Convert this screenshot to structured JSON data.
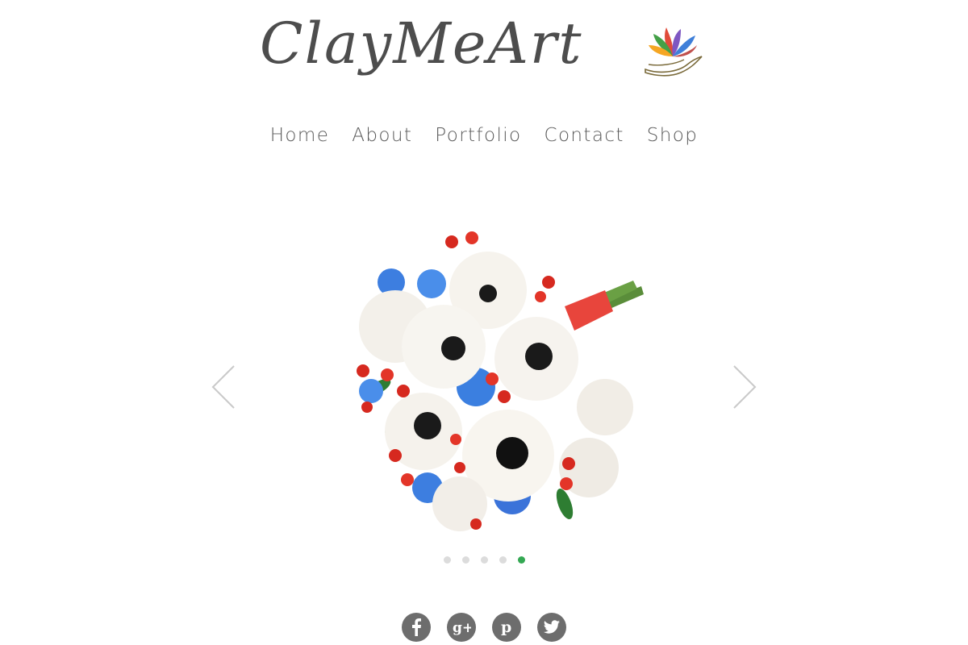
{
  "brand": {
    "name": "ClayMeArt",
    "logo_icon": "lotus-hand-icon"
  },
  "nav": {
    "items": [
      {
        "label": "Home"
      },
      {
        "label": "About"
      },
      {
        "label": "Portfolio"
      },
      {
        "label": "Contact"
      },
      {
        "label": "Shop"
      }
    ]
  },
  "slider": {
    "image_icon": "flower-bouquet-image",
    "prev_icon": "chevron-left-icon",
    "next_icon": "chevron-right-icon",
    "slide_count": 5,
    "active_slide": 5,
    "active_dot_color": "#34a853",
    "inactive_dot_color": "#dcdcdc"
  },
  "social": {
    "icons": [
      {
        "name": "facebook-icon",
        "glyph": "f"
      },
      {
        "name": "google-plus-icon",
        "glyph": "g+"
      },
      {
        "name": "pinterest-icon",
        "glyph": "p"
      },
      {
        "name": "twitter-icon",
        "glyph": "t"
      }
    ],
    "color": "#6d6d6d"
  }
}
